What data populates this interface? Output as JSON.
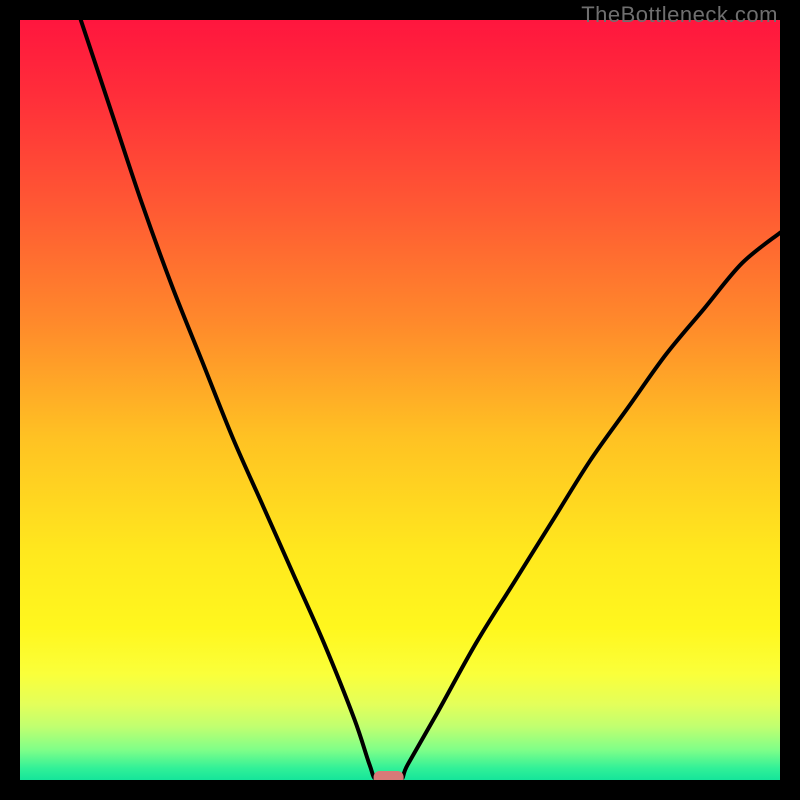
{
  "watermark": "TheBottleneck.com",
  "chart_data": {
    "type": "line",
    "title": "",
    "xlabel": "",
    "ylabel": "",
    "xlim": [
      0,
      100
    ],
    "ylim": [
      0,
      100
    ],
    "curve": {
      "name": "bottleneck-curve",
      "minimum_x": 48,
      "points": [
        {
          "x": 8,
          "y": 100
        },
        {
          "x": 12,
          "y": 88
        },
        {
          "x": 16,
          "y": 76
        },
        {
          "x": 20,
          "y": 65
        },
        {
          "x": 24,
          "y": 55
        },
        {
          "x": 28,
          "y": 45
        },
        {
          "x": 32,
          "y": 36
        },
        {
          "x": 36,
          "y": 27
        },
        {
          "x": 40,
          "y": 18
        },
        {
          "x": 44,
          "y": 8
        },
        {
          "x": 46,
          "y": 2
        },
        {
          "x": 47,
          "y": 0
        },
        {
          "x": 50,
          "y": 0
        },
        {
          "x": 51,
          "y": 2
        },
        {
          "x": 55,
          "y": 9
        },
        {
          "x": 60,
          "y": 18
        },
        {
          "x": 65,
          "y": 26
        },
        {
          "x": 70,
          "y": 34
        },
        {
          "x": 75,
          "y": 42
        },
        {
          "x": 80,
          "y": 49
        },
        {
          "x": 85,
          "y": 56
        },
        {
          "x": 90,
          "y": 62
        },
        {
          "x": 95,
          "y": 68
        },
        {
          "x": 100,
          "y": 72
        }
      ]
    },
    "marker": {
      "x": 48.5,
      "y": 0,
      "color": "#d87a78"
    },
    "gradient_stops": [
      {
        "offset": 0.0,
        "color": "#ff163e"
      },
      {
        "offset": 0.1,
        "color": "#ff2e3a"
      },
      {
        "offset": 0.25,
        "color": "#ff5a33"
      },
      {
        "offset": 0.4,
        "color": "#ff8a2b"
      },
      {
        "offset": 0.55,
        "color": "#ffc223"
      },
      {
        "offset": 0.7,
        "color": "#ffe81e"
      },
      {
        "offset": 0.8,
        "color": "#fff71e"
      },
      {
        "offset": 0.86,
        "color": "#faff3a"
      },
      {
        "offset": 0.9,
        "color": "#e4ff5a"
      },
      {
        "offset": 0.93,
        "color": "#c0ff70"
      },
      {
        "offset": 0.96,
        "color": "#80ff88"
      },
      {
        "offset": 0.985,
        "color": "#30f098"
      },
      {
        "offset": 1.0,
        "color": "#15e59a"
      }
    ]
  }
}
